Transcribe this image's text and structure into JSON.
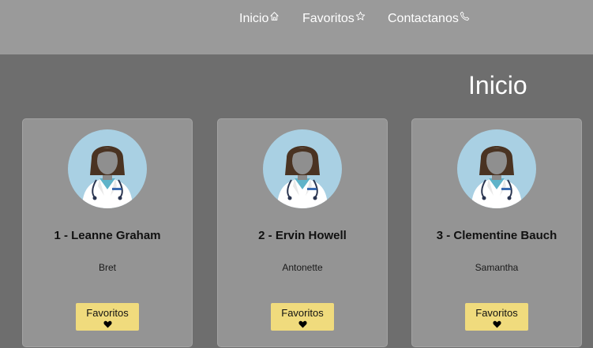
{
  "nav": {
    "items": [
      {
        "label": "Inicio",
        "icon": "home-icon"
      },
      {
        "label": "Favoritos",
        "icon": "star-icon"
      },
      {
        "label": "Contactanos",
        "icon": "phone-icon"
      }
    ]
  },
  "page": {
    "title": "Inicio"
  },
  "cards": [
    {
      "title": "1 - Leanne Graham",
      "username": "Bret",
      "button_label": "Favoritos",
      "button_icon": "heart-icon",
      "avatar": "doctor-avatar-icon"
    },
    {
      "title": "2 - Ervin Howell",
      "username": "Antonette",
      "button_label": "Favoritos",
      "button_icon": "heart-icon",
      "avatar": "doctor-avatar-icon"
    },
    {
      "title": "3 - Clementine Bauch",
      "username": "Samantha",
      "button_label": "Favoritos",
      "button_icon": "heart-icon",
      "avatar": "doctor-avatar-icon"
    }
  ],
  "colors": {
    "background": "#6e6e6e",
    "navbar": "#9a9a9a",
    "card": "#949494",
    "button": "#f0db7d",
    "avatar_bg": "#a9d0e3"
  }
}
